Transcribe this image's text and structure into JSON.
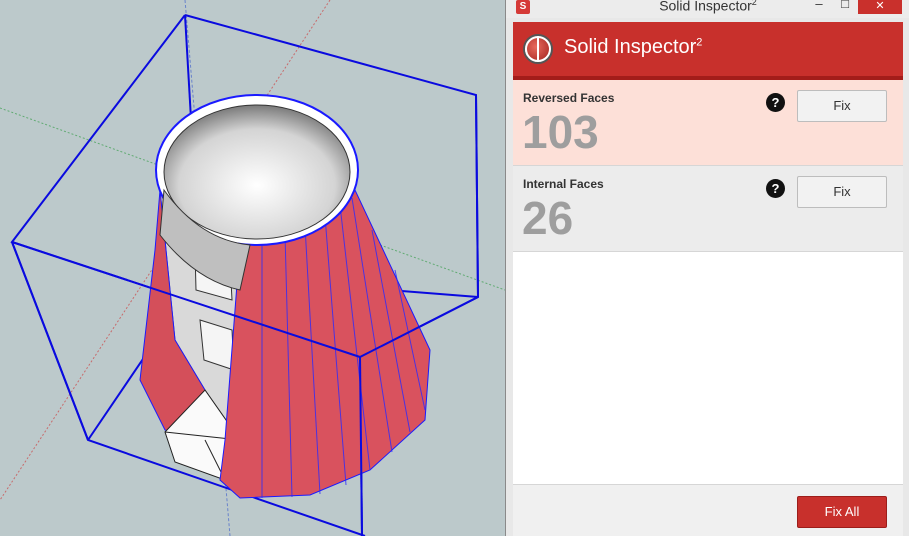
{
  "window": {
    "title": "Solid Inspector",
    "title_sup": "2",
    "minimize_icon": "minimize-icon",
    "maximize_icon": "maximize-icon",
    "close_icon": "close-icon",
    "minimize_glyph": "–",
    "maximize_glyph": "□",
    "close_glyph": "✕"
  },
  "header": {
    "app_name": "Solid Inspector",
    "app_name_sup": "2",
    "logo_icon": "globe-icon"
  },
  "issues": [
    {
      "label": "Reversed Faces",
      "count": "103",
      "help_glyph": "?",
      "fix_label": "Fix"
    },
    {
      "label": "Internal Faces",
      "count": "26",
      "help_glyph": "?",
      "fix_label": "Fix"
    }
  ],
  "footer": {
    "fix_all_label": "Fix All"
  },
  "colors": {
    "accent": "#c8302c",
    "reversed_row_bg": "#fde0d8",
    "internal_row_bg": "#ececec",
    "viewport_bg": "#bcc9cb",
    "model_reversed": "#d95460",
    "edge_selection": "#0000ff"
  }
}
